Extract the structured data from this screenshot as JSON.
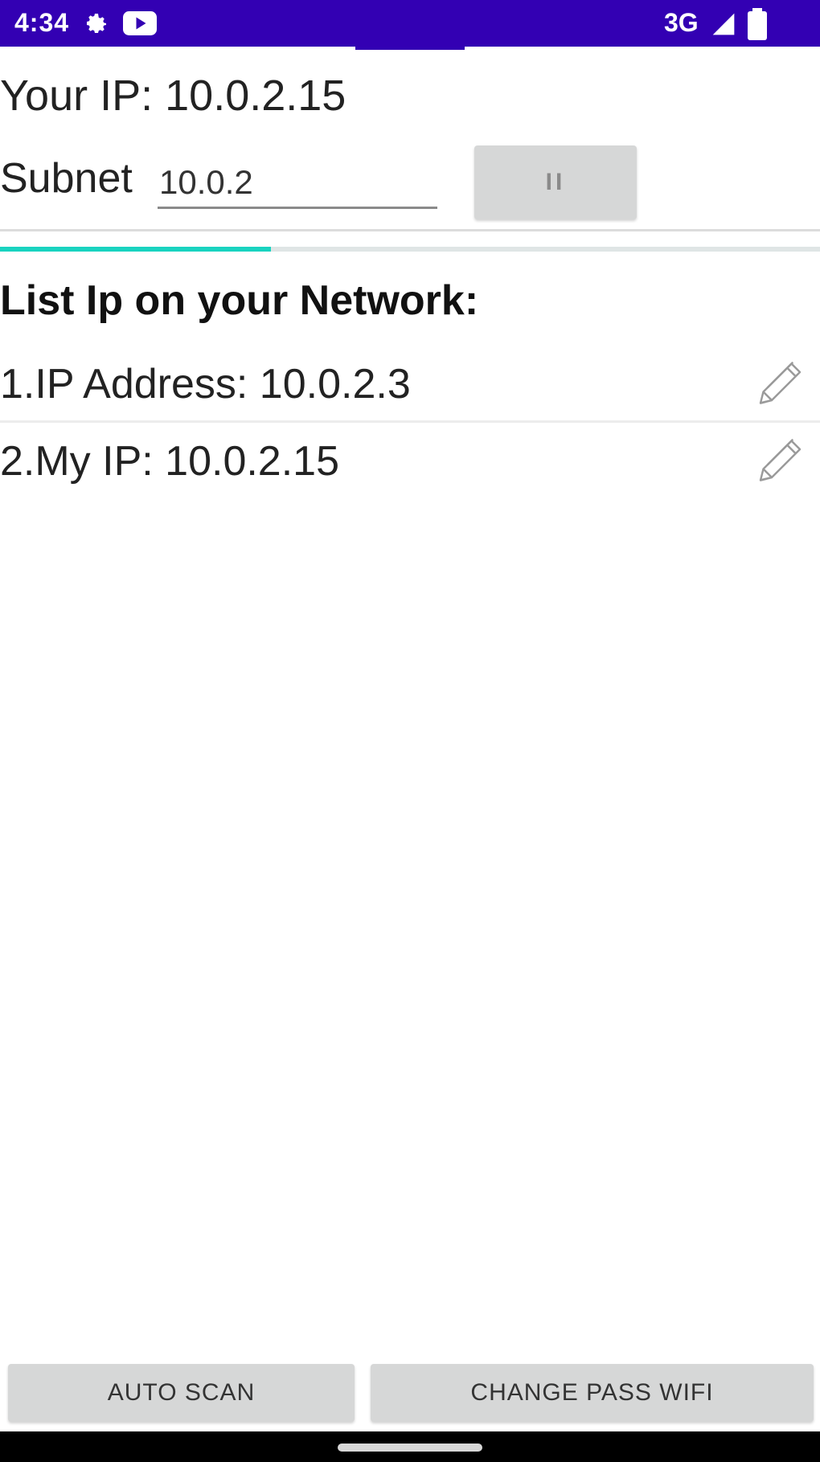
{
  "status_bar": {
    "time": "4:34",
    "network": "3G",
    "color": "#3300b3",
    "icons": [
      "gear-icon",
      "youtube-icon",
      "signal-icon",
      "battery-icon"
    ]
  },
  "main": {
    "your_ip_text": "Your IP: 10.0.2.15",
    "subnet_label": "Subnet",
    "subnet_value": "10.0.2",
    "pause_button_label": "II",
    "scan_progress": 0.33,
    "progress_color": "#19d3c0",
    "list_heading": "List Ip on your Network:",
    "ip_list": [
      {
        "text": "1.IP Address: 10.0.2.3",
        "icon": "pencil-icon"
      },
      {
        "text": "2.My IP: 10.0.2.15",
        "icon": "pencil-icon"
      }
    ]
  },
  "bottom_bar": {
    "auto_scan_label": "AUTO SCAN",
    "change_pass_label": "CHANGE PASS WIFI"
  }
}
